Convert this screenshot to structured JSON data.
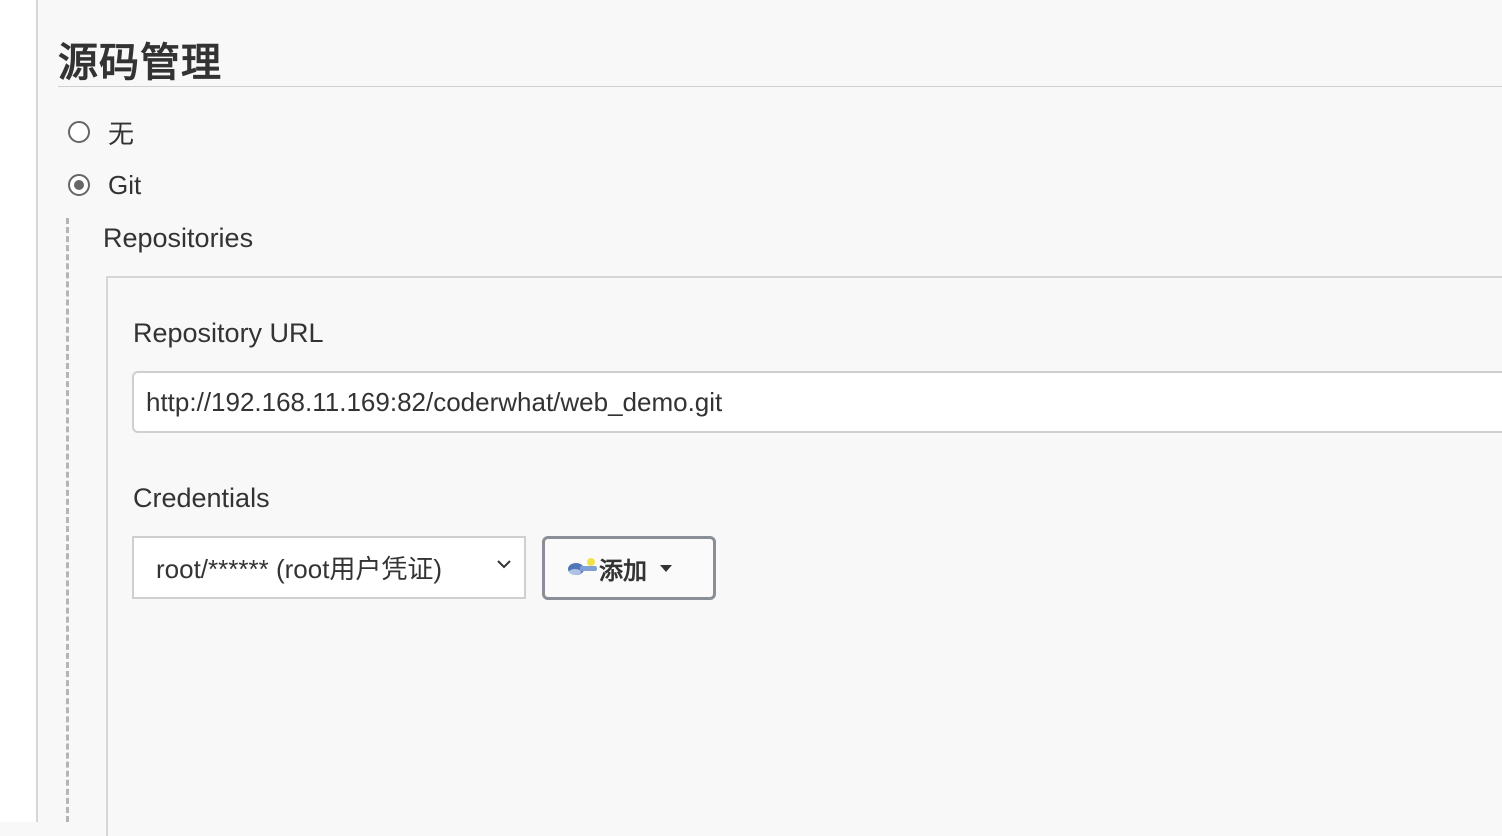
{
  "section": {
    "title": "源码管理"
  },
  "scm_options": [
    {
      "label": "无",
      "checked": false
    },
    {
      "label": "Git",
      "checked": true
    }
  ],
  "git": {
    "repositories_label": "Repositories",
    "repository_url_label": "Repository URL",
    "repository_url_value": "http://192.168.11.169:82/coderwhat/web_demo.git",
    "credentials_label": "Credentials",
    "credentials_selected": "root/****** (root用户凭证)",
    "add_button_label": "添加",
    "add_button_icon": "key-icon"
  }
}
